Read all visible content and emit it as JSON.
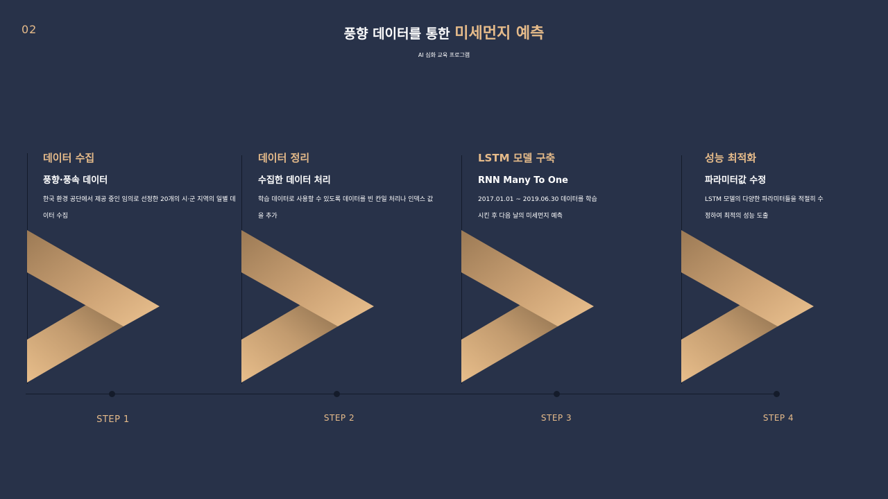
{
  "header": {
    "page_number": "02",
    "title_white": "풍향 데이터를 통한",
    "title_highlight": "미세먼지 예측",
    "subtitle": "AI 심화 교육 프로그램"
  },
  "colors": {
    "background": "#283249",
    "accent": "#e6bb8a",
    "line": "#141b2a"
  },
  "steps": [
    {
      "title": "데이터 수집",
      "subtitle": "풍향·풍속 데이터",
      "description": "한국 환경 공단에서 제공 중인 임의로 선정한 20개의 시·군 지역의 일별 데이터 수집",
      "label": "STEP 1"
    },
    {
      "title": "데이터 정리",
      "subtitle": "수집한 데이터 처리",
      "description": "학습 데이터로 사용할 수 있도록 데이터를 빈 칸일 처리나 인덱스 값을 추가",
      "label": "STEP 2"
    },
    {
      "title": "LSTM 모델 구축",
      "subtitle": "RNN Many To One",
      "description": "2017.01.01 ~ 2019.06.30 데이터를 학습 시킨 후 다음 날의 미세먼지 예측",
      "label": "STEP 3"
    },
    {
      "title": "성능 최적화",
      "subtitle": "파라미터값 수정",
      "description": "LSTM 모델의 다양한 파라미터들을 적절히 수정하여 최적의 성능 도출",
      "label": "STEP 4"
    }
  ]
}
